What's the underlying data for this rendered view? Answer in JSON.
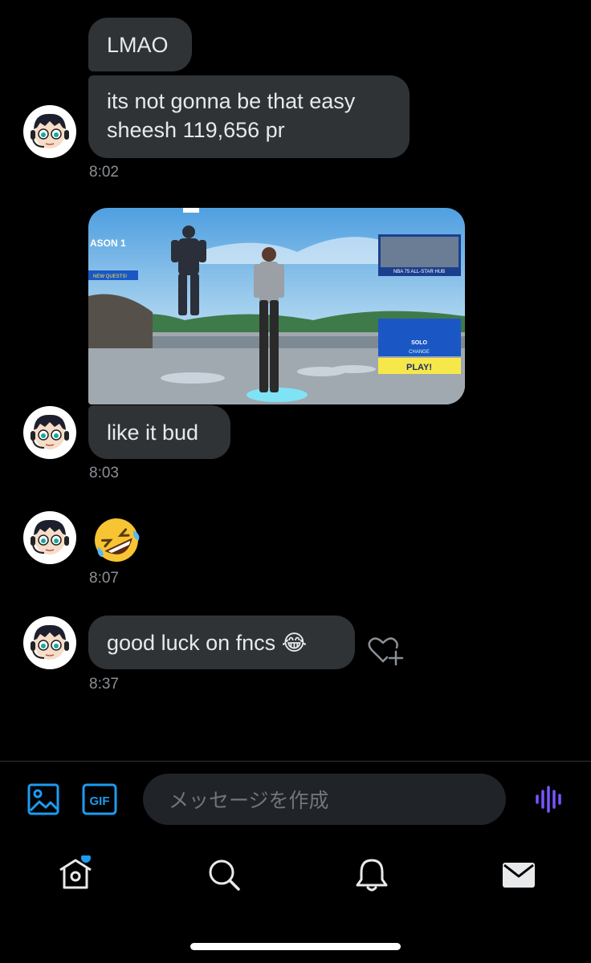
{
  "messages": [
    {
      "text": "LMAO"
    },
    {
      "line1": "its not gonna be that easy",
      "line2": "sheesh 119,656 pr",
      "time": "8:02"
    },
    {
      "type": "image",
      "image_description": "Fortnite lobby screenshot with character, SOLO mode and PLAY button",
      "game_text": {
        "season": "ASON 1",
        "new_quests": "NEW QUESTS!",
        "mode": "SOLO",
        "change": "CHANGE",
        "play": "PLAY!",
        "hub": "NBA 75 ALL-STAR HUB"
      }
    },
    {
      "text": "like it bud",
      "time": "8:03"
    },
    {
      "emoji": "🤣",
      "time": "8:07"
    },
    {
      "text": "good luck on fncs 😂",
      "time": "8:37"
    }
  ],
  "composer": {
    "placeholder": "メッセージを作成",
    "gif_label": "GIF"
  },
  "icons": {
    "image": "image-icon",
    "gif": "gif-icon",
    "voice": "voice-icon",
    "home": "home-icon",
    "search": "search-icon",
    "notifications": "bell-icon",
    "messages": "mail-icon",
    "react": "heart-plus-icon"
  },
  "colors": {
    "background": "#000000",
    "bubble": "#2f3336",
    "accent_blue": "#1d9bf0",
    "voice_purple": "#7856ff",
    "timestamp": "#8b9096"
  },
  "nav": {
    "home_badge": true
  }
}
